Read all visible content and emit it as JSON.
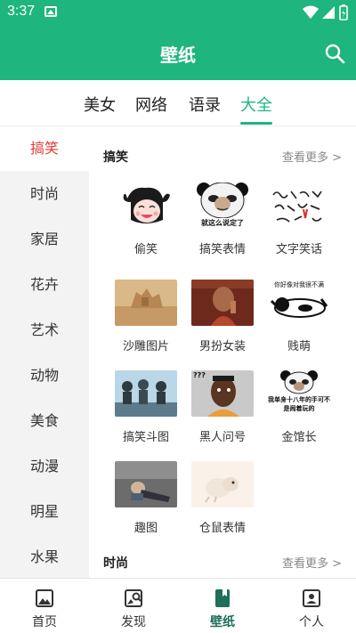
{
  "status_bar": {
    "time": "3:37"
  },
  "app_bar": {
    "title": "壁纸"
  },
  "tabs": [
    {
      "label": "美女",
      "active": false
    },
    {
      "label": "网络",
      "active": false
    },
    {
      "label": "语录",
      "active": false
    },
    {
      "label": "大全",
      "active": true
    }
  ],
  "categories": [
    "搞笑",
    "时尚",
    "家居",
    "花卉",
    "艺术",
    "动物",
    "美食",
    "动漫",
    "明星",
    "水果"
  ],
  "active_category": "搞笑",
  "sections": [
    {
      "title": "搞笑",
      "more": "查看更多 >",
      "items": [
        {
          "label": "偷笑"
        },
        {
          "label": "搞笑表情",
          "caption": "就这么说定了"
        },
        {
          "label": "文字笑话"
        },
        {
          "label": "沙雕图片"
        },
        {
          "label": "男扮女装"
        },
        {
          "label": "贱萌",
          "caption": "你好像对我很不满"
        },
        {
          "label": "搞笑斗图"
        },
        {
          "label": "黑人问号",
          "caption": "???"
        },
        {
          "label": "金馆长",
          "caption": "我单身十八年的手可不是闹着玩的"
        },
        {
          "label": "趣图"
        },
        {
          "label": "仓鼠表情"
        }
      ]
    },
    {
      "title": "时尚",
      "more": "查看更多 >"
    }
  ],
  "bottom_nav": [
    {
      "label": "首页",
      "icon": "image-icon",
      "active": false
    },
    {
      "label": "发现",
      "icon": "image-search-icon",
      "active": false
    },
    {
      "label": "壁纸",
      "icon": "book-icon",
      "active": true
    },
    {
      "label": "个人",
      "icon": "person-card-icon",
      "active": false
    }
  ],
  "colors": {
    "primary": "#1fb57f",
    "active_category": "#e53935",
    "nav_active": "#1f6f5a"
  }
}
